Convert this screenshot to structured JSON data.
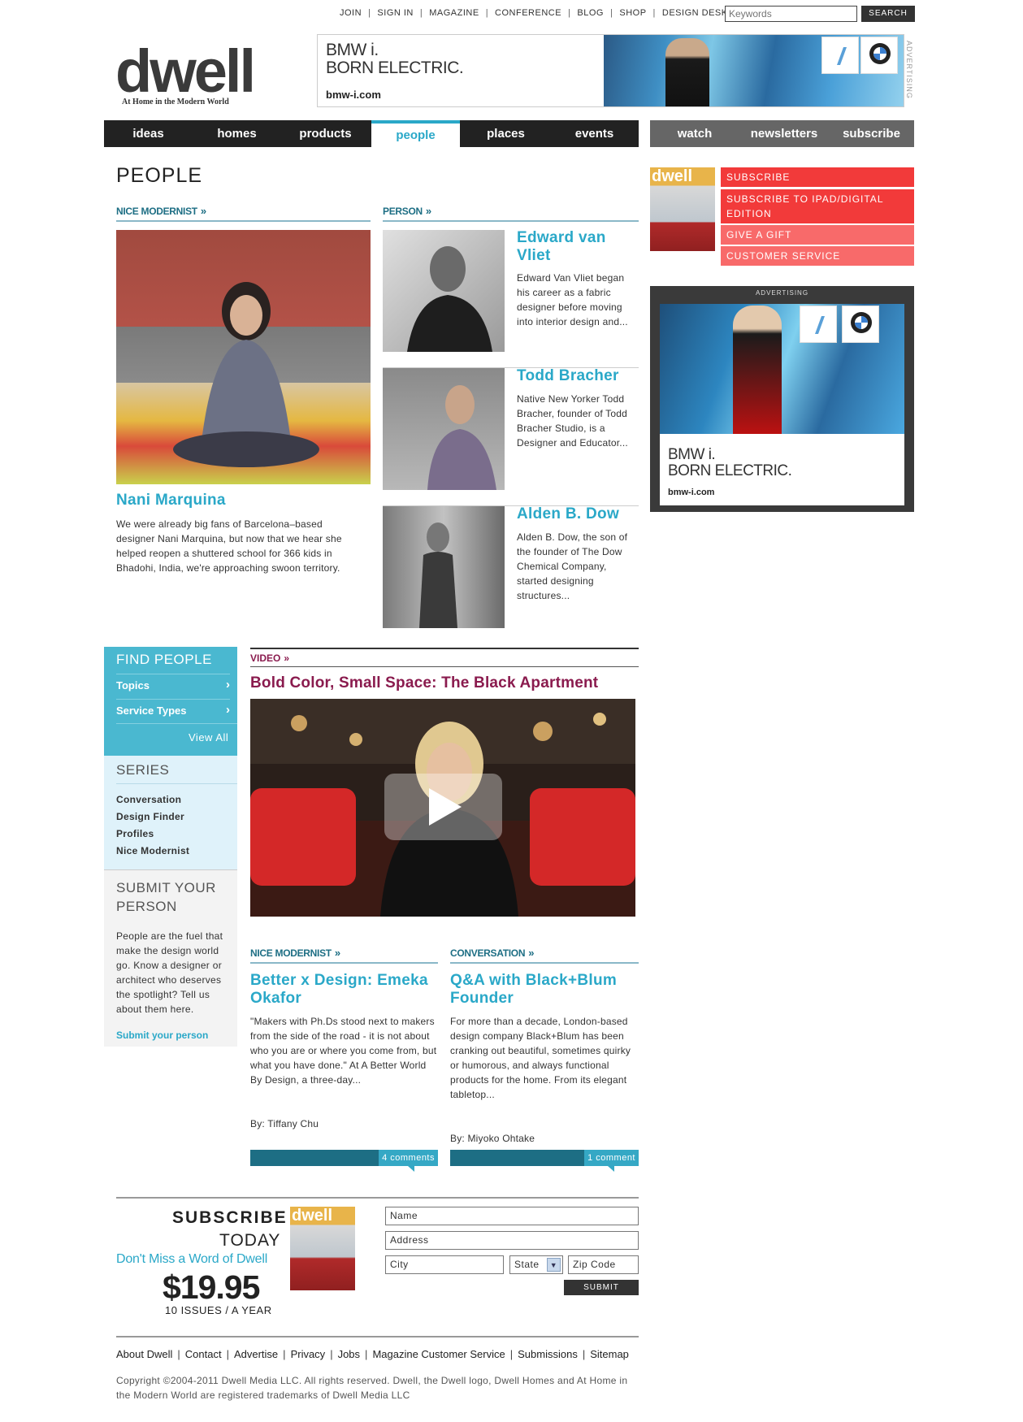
{
  "util_nav": [
    "JOIN",
    "SIGN IN",
    "MAGAZINE",
    "CONFERENCE",
    "BLOG",
    "SHOP",
    "DESIGN DESK"
  ],
  "search": {
    "placeholder": "Keywords",
    "button": "SEARCH"
  },
  "logo": {
    "word": "dwell",
    "tagline": "At Home in the Modern World"
  },
  "banner_ad": {
    "line1": "BMW i.",
    "line2": "BORN ELECTRIC.",
    "url": "bmw-i.com",
    "label": "ADVERTISING"
  },
  "main_nav": [
    "ideas",
    "homes",
    "products",
    "people",
    "places",
    "events"
  ],
  "main_nav_active": "people",
  "secondary_nav": [
    "watch",
    "newsletters",
    "subscribe"
  ],
  "page_title": "PEOPLE",
  "feature": {
    "section": "NICE MODERNIST",
    "name": "Nani Marquina",
    "text": "We were already big fans of Barcelona–based designer Nani Marquina, but now that we hear she helped reopen a shuttered school for 366 kids in Bhadohi, India, we're approaching swoon territory."
  },
  "person": {
    "section": "PERSON",
    "items": [
      {
        "name": "Edward van Vliet",
        "text": "Edward Van Vliet began his career as a fabric designer before moving into interior design and..."
      },
      {
        "name": "Todd Bracher",
        "text": "Native New Yorker Todd Bracher, founder of Todd Bracher Studio, is a Designer and Educator..."
      },
      {
        "name": "Alden B. Dow",
        "text": "Alden B. Dow, the son of the founder of The Dow Chemical Company, started designing structures..."
      }
    ]
  },
  "sidebar": {
    "subscribe_links": [
      "SUBSCRIBE",
      "SUBSCRIBE TO IPAD/DIGITAL EDITION",
      "GIVE A GIFT",
      "CUSTOMER SERVICE"
    ],
    "ad": {
      "label": "ADVERTISING",
      "line1": "BMW i.",
      "line2": "BORN ELECTRIC.",
      "url": "bmw-i.com"
    }
  },
  "find_people": {
    "title": "FIND PEOPLE",
    "items": [
      "Topics",
      "Service Types"
    ],
    "view_all": "View All",
    "series_title": "SERIES",
    "series": [
      "Conversation",
      "Design Finder",
      "Profiles",
      "Nice Modernist"
    ],
    "submit_title": "SUBMIT YOUR PERSON",
    "submit_text": "People are the fuel that make the design world go. Know a designer or architect who deserves the spotlight? Tell us about them here.",
    "submit_link": "Submit your person"
  },
  "video": {
    "section": "VIDEO",
    "title": "Bold Color, Small Space: The Black Apartment"
  },
  "stories": [
    {
      "section": "NICE MODERNIST",
      "title": "Better x Design: Emeka Okafor",
      "text": "\"Makers with Ph.Ds stood next to makers from the side of the road - it is not about who you are or where you come from, but what you have done.\" At A Better World By Design, a three-day...",
      "byline": "By: Tiffany Chu",
      "comments": "4 comments"
    },
    {
      "section": "CONVERSATION",
      "title": "Q&A with Black+Blum Founder",
      "text": "For more than a decade, London-based design company Black+Blum has been cranking out beautiful, sometimes quirky or humorous, and always functional products for the home. From its elegant tabletop...",
      "byline": "By: Miyoko Ohtake",
      "comments": "1 comment"
    }
  ],
  "subscribe": {
    "w1": "SUBSCRIBE",
    "w2": "TODAY",
    "tag": "Don't Miss a Word of Dwell",
    "price": "$19.95",
    "issues": "10 ISSUES / A YEAR",
    "fields": {
      "name": "Name",
      "address": "Address",
      "city": "City",
      "state": "State",
      "zip": "Zip Code"
    },
    "button": "SUBMIT"
  },
  "footer": {
    "links": [
      "About Dwell",
      "Contact",
      "Advertise",
      "Privacy",
      "Jobs",
      "Magazine Customer Service",
      "Submissions",
      "Sitemap"
    ],
    "copyright": "Copyright ©2004-2011 Dwell Media LLC. All rights reserved. Dwell, the Dwell logo, Dwell Homes and At Home in the Modern World are registered trademarks of Dwell Media LLC"
  },
  "colors": {
    "accent": "#2aa8c8",
    "teal_dark": "#1d6e84",
    "video": "#8a1b4e",
    "red": "#f23a3a"
  }
}
